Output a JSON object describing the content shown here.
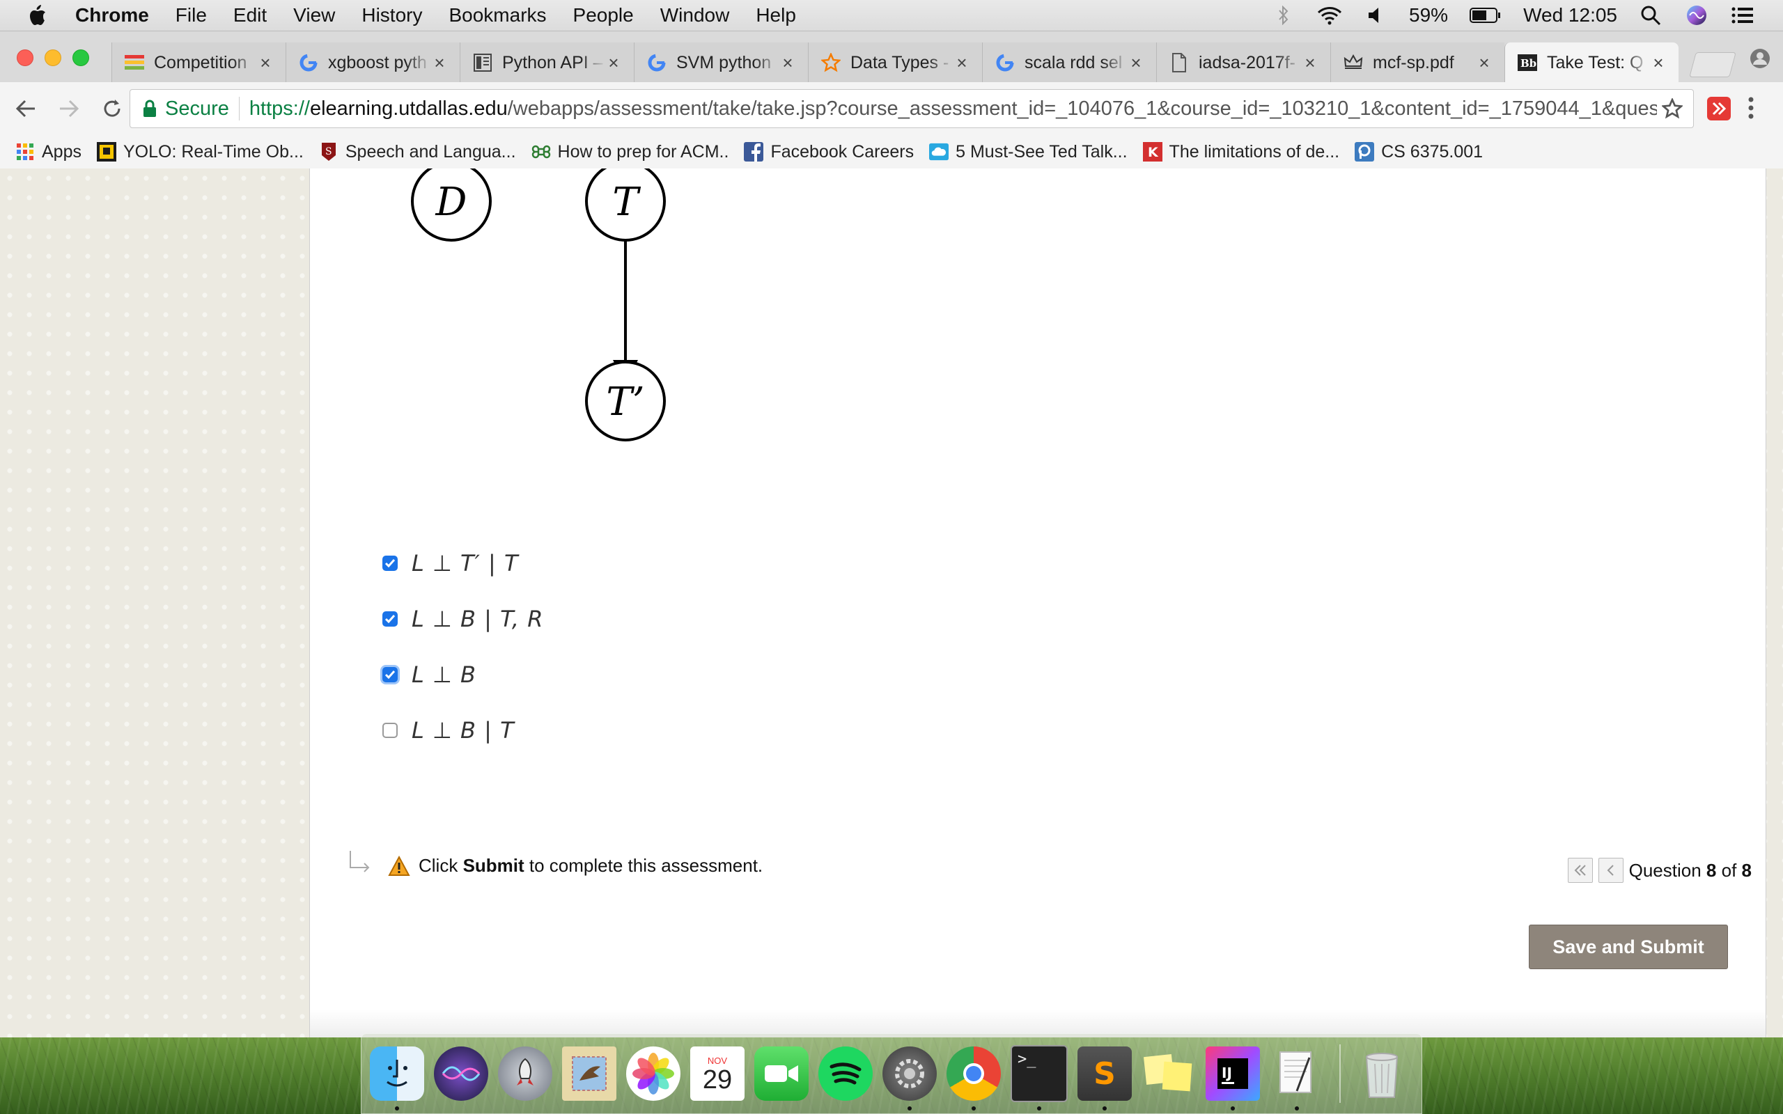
{
  "menubar": {
    "app_name": "Chrome",
    "items": [
      "File",
      "Edit",
      "View",
      "History",
      "Bookmarks",
      "People",
      "Window",
      "Help"
    ],
    "battery": "59%",
    "clock": "Wed 12:05"
  },
  "tabs": [
    {
      "label": "Competition",
      "icon": "competition-favicon"
    },
    {
      "label": "xgboost pyth",
      "icon": "google-favicon"
    },
    {
      "label": "Python API –",
      "icon": "docs-favicon"
    },
    {
      "label": "SVM python",
      "icon": "google-favicon"
    },
    {
      "label": "Data Types -",
      "icon": "star-favicon"
    },
    {
      "label": "scala rdd sel",
      "icon": "google-favicon"
    },
    {
      "label": "iadsa-2017f-",
      "icon": "file-favicon"
    },
    {
      "label": "mcf-sp.pdf",
      "icon": "crown-favicon"
    },
    {
      "label": "Take Test: Q",
      "icon": "blackboard-favicon"
    }
  ],
  "toolbar": {
    "secure_label": "Secure",
    "url_scheme": "https://",
    "url_host": "elearning.utdallas.edu",
    "url_path": "/webapps/assessment/take/take.jsp?course_assessment_id=_104076_1&course_id=_103210_1&content_id=_1759044_1&questi..."
  },
  "bookmarks": [
    {
      "label": "Apps",
      "icon": "apps-grid-icon"
    },
    {
      "label": "YOLO: Real-Time Ob...",
      "icon": "yolo-favicon"
    },
    {
      "label": "Speech and Langua...",
      "icon": "stanford-favicon"
    },
    {
      "label": "How to prep for ACM..",
      "icon": "cmd-favicon"
    },
    {
      "label": "Facebook Careers",
      "icon": "facebook-favicon"
    },
    {
      "label": "5 Must-See Ted Talk...",
      "icon": "cloud-favicon"
    },
    {
      "label": "The limitations of de...",
      "icon": "k-favicon"
    },
    {
      "label": "CS 6375.001",
      "icon": "p-favicon"
    }
  ],
  "graph": {
    "nodes": [
      "D",
      "T",
      "T’"
    ]
  },
  "options": [
    {
      "text": "L ⊥ T′ | T",
      "checked": true
    },
    {
      "text": "L ⊥ B | T, R",
      "checked": true
    },
    {
      "text": "L ⊥ B",
      "checked": true
    },
    {
      "text": "L ⊥ B | T",
      "checked": false
    }
  ],
  "footer": {
    "note_prefix": "Click ",
    "note_bold": "Submit",
    "note_suffix": " to complete this assessment.",
    "question_word": "Question ",
    "question_current": "8",
    "question_of": " of ",
    "question_total": "8",
    "save_submit_label": "Save and Submit"
  },
  "dock": [
    "finder",
    "siri",
    "launchpad",
    "mail",
    "photos",
    "calendar",
    "facetime",
    "spotify",
    "system-preferences",
    "chrome",
    "terminal",
    "sublime-text",
    "stickies",
    "intellij",
    "textedit",
    "trash"
  ],
  "dock_calendar": {
    "month": "NOV",
    "day": "29"
  }
}
